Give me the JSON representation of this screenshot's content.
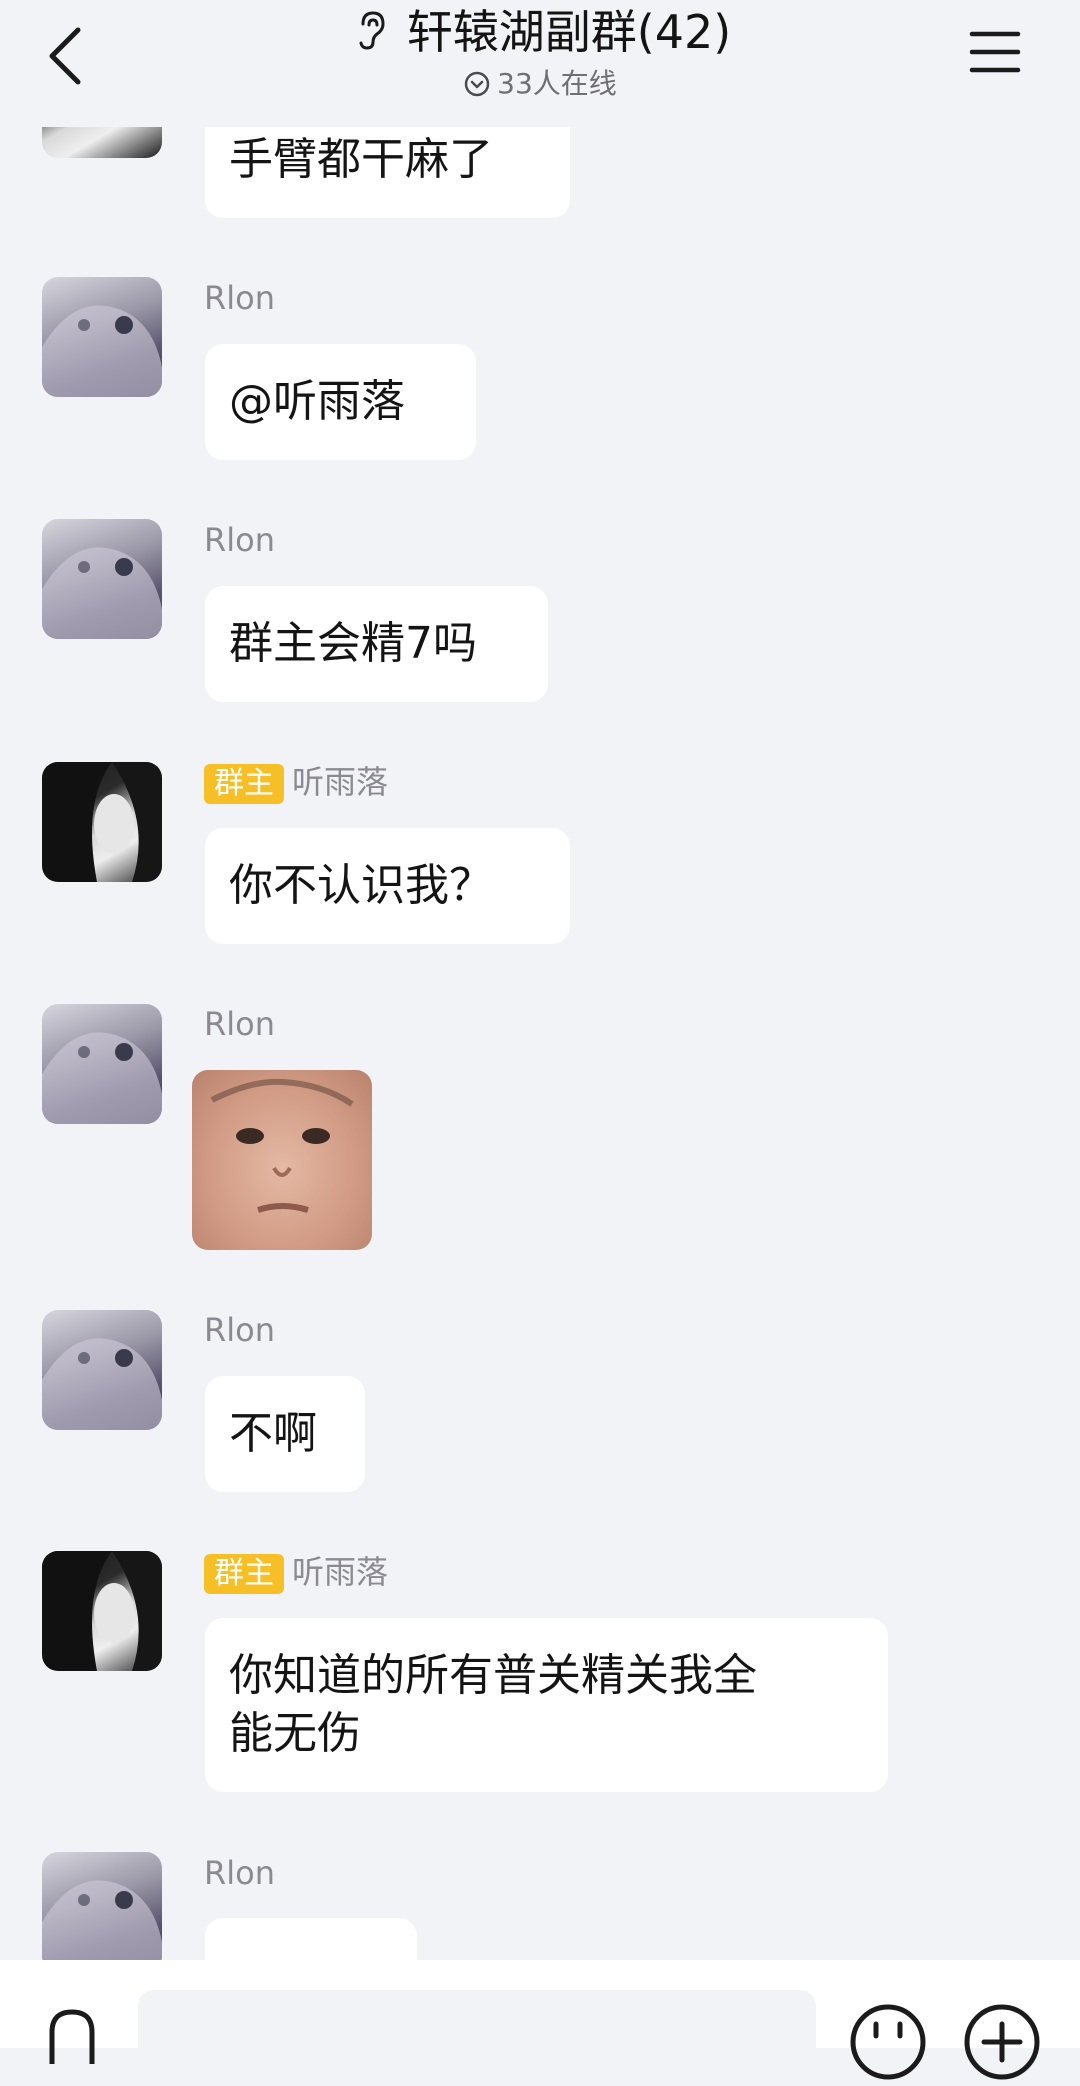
{
  "header": {
    "title": "轩辕湖副群(42)",
    "online": "33人在线"
  },
  "messages": [
    {
      "sender": "",
      "text": "手臂都干麻了"
    },
    {
      "sender": "Rlon",
      "text": "@听雨落"
    },
    {
      "sender": "Rlon",
      "text": "群主会精7吗"
    },
    {
      "badge": "群主",
      "sender": "听雨落",
      "text": "你不认识我？"
    },
    {
      "sender": "Rlon",
      "sticker": "baby-face-sticker"
    },
    {
      "sender": "Rlon",
      "text": "不啊"
    },
    {
      "badge": "群主",
      "sender": "听雨落",
      "text_line1": "你知道的所有普关精关我全",
      "text_line2": "能无伤"
    },
    {
      "sender": "Rlon"
    }
  ],
  "icons": {
    "back": "chevron-left-icon",
    "menu": "hamburger-icon",
    "ear": "ear-icon",
    "online": "chevron-down-circle-icon",
    "voice": "microphone-icon",
    "emoji": "smiley-icon",
    "plus": "plus-circle-icon"
  },
  "colors": {
    "background": "#f2f3f7",
    "bubble": "#ffffff",
    "owner_badge": "#f6bf26",
    "sender_name": "#8a8a90"
  }
}
